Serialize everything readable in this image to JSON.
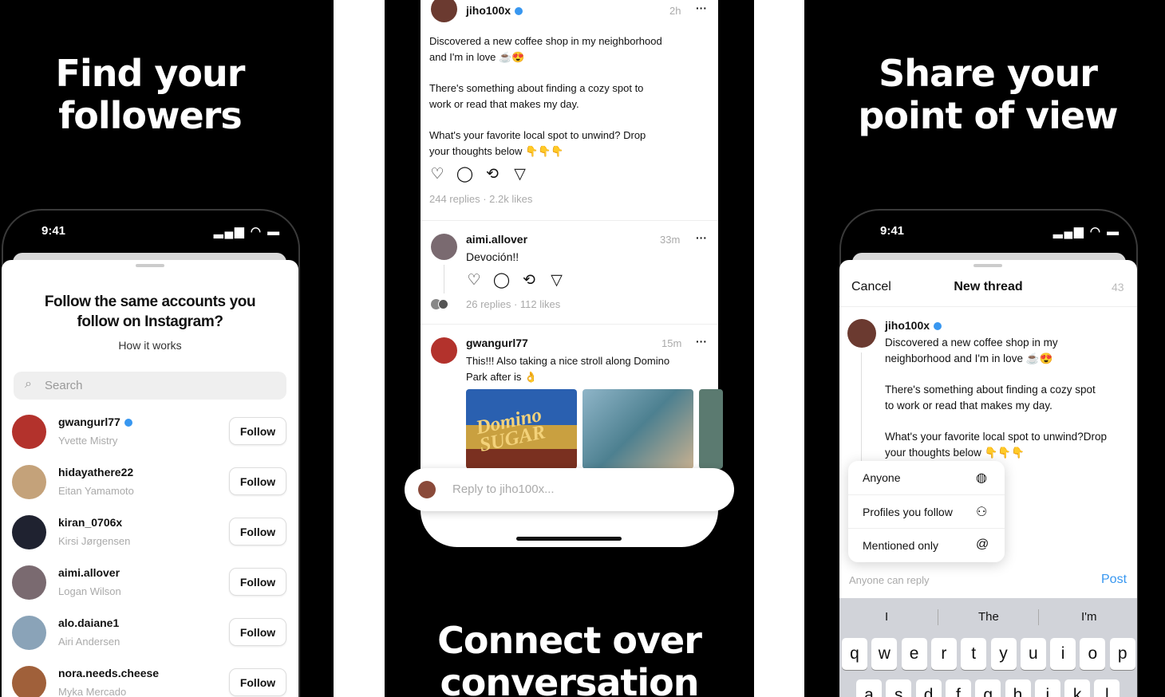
{
  "colors": {
    "accent": "#3897f0",
    "background": "#000000"
  },
  "panel1": {
    "headline": [
      "Find your",
      "followers"
    ],
    "time": "9:41",
    "heading": [
      "Follow the same accounts you",
      "follow on Instagram?"
    ],
    "how_it_works": "How it works",
    "search_placeholder": "Search",
    "follow_label": "Follow",
    "accounts": [
      {
        "username": "gwangurl77",
        "name": "Yvette Mistry",
        "verified": true,
        "color": "#b3322c"
      },
      {
        "username": "hidayathere22",
        "name": "Eitan Yamamoto",
        "verified": false,
        "color": "#c4a27a"
      },
      {
        "username": "kiran_0706x",
        "name": "Kirsi Jørgensen",
        "verified": false,
        "color": "#1f2230"
      },
      {
        "username": "aimi.allover",
        "name": "Logan Wilson",
        "verified": false,
        "color": "#7a6a70"
      },
      {
        "username": "alo.daiane1",
        "name": "Airi Andersen",
        "verified": false,
        "color": "#8aa3b8"
      },
      {
        "username": "nora.needs.cheese",
        "name": "Myka Mercado",
        "verified": false,
        "color": "#a0603a"
      }
    ]
  },
  "panel2": {
    "post": {
      "username": "jiho100x",
      "time": "2h",
      "lines": [
        "Discovered a new coffee shop in my neighborhood",
        "and I'm in love ☕😍",
        "There's something about finding a cozy spot to",
        "work or read that makes my day.",
        "What's your favorite local spot to unwind? Drop",
        "your thoughts below 👇👇👇"
      ],
      "stats": "244 replies · 2.2k likes"
    },
    "reply1": {
      "username": "aimi.allover",
      "time": "33m",
      "text": "Devoción!!",
      "stats": "26 replies · 112 likes"
    },
    "reply2": {
      "username": "gwangurl77",
      "time": "15m",
      "lines": [
        "This!!! Also taking a nice stroll along Domino",
        "Park after is 👌"
      ],
      "image_text": "Domino SUGAR"
    },
    "reply_placeholder": "Reply to jiho100x...",
    "headline": [
      "Connect over",
      "conversation"
    ]
  },
  "panel3": {
    "headline": [
      "Share your",
      "point of view"
    ],
    "time": "9:41",
    "cancel": "Cancel",
    "title": "New thread",
    "char_count": "43",
    "username": "jiho100x",
    "lines": [
      "Discovered a new coffee shop in my",
      "neighborhood and I'm in love ☕😍",
      "There's something about finding a cozy spot",
      "to work or read that makes my day.",
      "What's your favorite local spot to unwind?Drop",
      "your thoughts below 👇👇👇"
    ],
    "reply_options": [
      {
        "label": "Anyone",
        "icon": "globe-icon"
      },
      {
        "label": "Profiles you follow",
        "icon": "people-icon"
      },
      {
        "label": "Mentioned only",
        "icon": "at-icon"
      }
    ],
    "reply_setting": "Anyone can reply",
    "post": "Post",
    "suggestions": [
      "I",
      "The",
      "I'm"
    ],
    "keys_row1": [
      "q",
      "w",
      "e",
      "r",
      "t",
      "y",
      "u",
      "i",
      "o",
      "p"
    ],
    "keys_row2": [
      "a",
      "s",
      "d",
      "f",
      "g",
      "h",
      "j",
      "k",
      "l"
    ]
  }
}
